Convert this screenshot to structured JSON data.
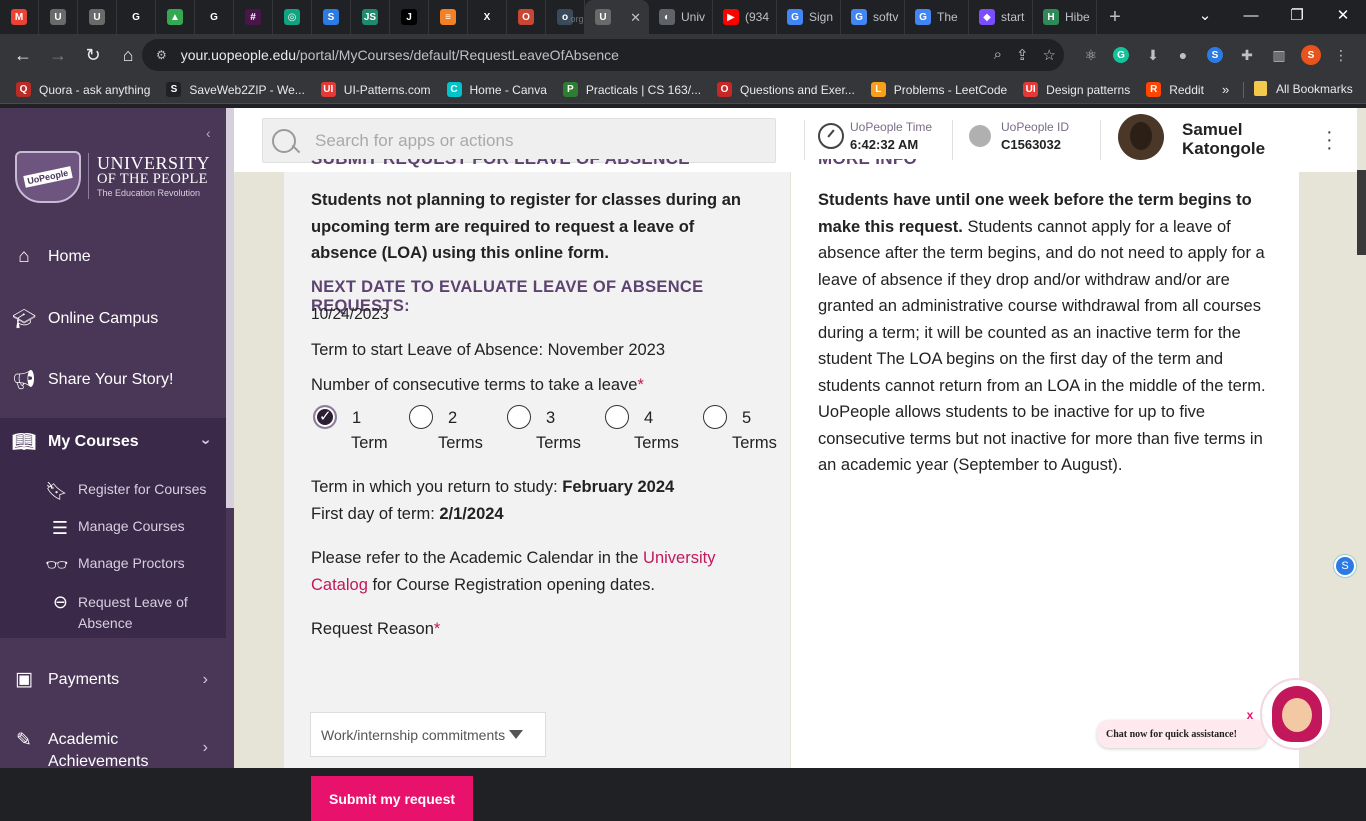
{
  "browser": {
    "tabs": [
      {
        "icon": "gmail-icon",
        "letter": "M",
        "color": "#ea4335"
      },
      {
        "icon": "uopeople-tab-icon",
        "letter": "U",
        "color": "#6a6a6a"
      },
      {
        "icon": "uopeople-tab-icon",
        "letter": "U",
        "color": "#6a6a6a"
      },
      {
        "icon": "github-icon",
        "letter": "G",
        "color": "#202124"
      },
      {
        "icon": "google-drive-icon",
        "letter": "▲",
        "color": "#34a853"
      },
      {
        "icon": "github-icon",
        "letter": "G",
        "color": "#202124"
      },
      {
        "icon": "slack-icon",
        "letter": "#",
        "color": "#4a154b"
      },
      {
        "icon": "chatgpt-icon",
        "letter": "◎",
        "color": "#10a37f"
      },
      {
        "icon": "s-icon",
        "letter": "S",
        "color": "#2c7be5"
      },
      {
        "icon": "js-icon",
        "letter": "JS",
        "color": "#1f8a70"
      },
      {
        "icon": "j-icon",
        "letter": "J",
        "color": "#000000"
      },
      {
        "icon": "stackoverflow-icon",
        "letter": "≡",
        "color": "#f48024"
      },
      {
        "icon": "x-icon",
        "letter": "X",
        "color": "#202124"
      },
      {
        "icon": "oracle-icon",
        "letter": "O",
        "color": "#c74634"
      },
      {
        "icon": "org-icon",
        "letter": "o",
        "color": "#3b4a5a",
        "title": ".org"
      }
    ],
    "active_tab_icon": "uopeople-tab-icon",
    "titled_tabs": [
      {
        "icon": "globe-icon",
        "letter": "◐",
        "color": "#5f6368",
        "title": "Univ"
      },
      {
        "icon": "youtube-icon",
        "letter": "▶",
        "color": "#ff0000",
        "title": "(934"
      },
      {
        "icon": "google-icon",
        "letter": "G",
        "color": "#4285f4",
        "title": "Sign"
      },
      {
        "icon": "google-icon",
        "letter": "G",
        "color": "#4285f4",
        "title": "softv"
      },
      {
        "icon": "google-icon",
        "letter": "G",
        "color": "#4285f4",
        "title": "The"
      },
      {
        "icon": "app-icon",
        "letter": "◆",
        "color": "#7b4dff",
        "title": "start"
      },
      {
        "icon": "hibernate-icon",
        "letter": "H",
        "color": "#2e8b57",
        "title": "Hibe"
      }
    ],
    "url_domain": "your.uopeople.edu",
    "url_path": "/portal/MyCourses/default/RequestLeaveOfAbsence",
    "bookmarks": [
      {
        "label": "Quora - ask anything",
        "letter": "Q",
        "color": "#b92b27"
      },
      {
        "label": "SaveWeb2ZIP - We...",
        "letter": "S",
        "color": "#202124"
      },
      {
        "label": "UI-Patterns.com",
        "letter": "UI",
        "color": "#e53935"
      },
      {
        "label": "Home - Canva",
        "letter": "C",
        "color": "#00c4cc"
      },
      {
        "label": "Practicals | CS 163/...",
        "letter": "P",
        "color": "#2e7d32"
      },
      {
        "label": "Questions and Exer...",
        "letter": "O",
        "color": "#c62828"
      },
      {
        "label": "Problems - LeetCode",
        "letter": "L",
        "color": "#f89f1b"
      },
      {
        "label": "Design patterns",
        "letter": "UI",
        "color": "#e53935"
      },
      {
        "label": "Reddit",
        "letter": "R",
        "color": "#ff4500"
      }
    ],
    "bookmarks_overflow": "»",
    "all_bookmarks": "All Bookmarks"
  },
  "sidebar": {
    "logo": {
      "badge": "UoPeople",
      "line1": "UNIVERSITY",
      "line2": "OF THE PEOPLE",
      "line3": "The Education Revolution"
    },
    "items": [
      {
        "label": "Home",
        "icon": "home-icon"
      },
      {
        "label": "Online Campus",
        "icon": "graduation-cap-icon"
      },
      {
        "label": "Share Your Story!",
        "icon": "megaphone-icon"
      },
      {
        "label": "My Courses",
        "icon": "book-icon"
      },
      {
        "label": "Payments",
        "icon": "wallet-icon"
      },
      {
        "label": "Academic Achievements",
        "icon": "pencil-icon"
      }
    ],
    "subitems": [
      {
        "label": "Register for Courses",
        "icon": "bookmark-icon"
      },
      {
        "label": "Manage Courses",
        "icon": "list-check-icon"
      },
      {
        "label": "Manage Proctors",
        "icon": "glasses-icon"
      },
      {
        "label": "Request Leave of Absence",
        "icon": "minus-circle-icon"
      }
    ]
  },
  "topbar": {
    "search_placeholder": "Search for apps or actions",
    "time_label": "UoPeople Time",
    "time_value": "6:42:32 AM",
    "id_label": "UoPeople ID",
    "id_value": "C1563032",
    "user_first": "Samuel",
    "user_last": "Katongole"
  },
  "form": {
    "heading_cut": "SUBMIT REQUEST FOR LEAVE OF ABSENCE",
    "intro": "Students not planning to register for classes during an upcoming term are required to request a leave of absence (LOA) using this online form.",
    "next_date_heading": "NEXT DATE TO EVALUATE LEAVE OF ABSENCE REQUESTS:",
    "next_date": "10/24/2023",
    "term_start": "Term to start Leave of Absence: November 2023",
    "terms_label": "Number of consecutive terms to take a leave",
    "required_mark": "*",
    "term_options": [
      {
        "num": "1",
        "word": "Term",
        "checked": true
      },
      {
        "num": "2",
        "word": "Terms",
        "checked": false
      },
      {
        "num": "3",
        "word": "Terms",
        "checked": false
      },
      {
        "num": "4",
        "word": "Terms",
        "checked": false
      },
      {
        "num": "5",
        "word": "Terms",
        "checked": false
      }
    ],
    "return_label": "Term in which you return to study:",
    "return_value": "February 2024",
    "first_day_label": "First day of term:",
    "first_day_value": "2/1/2024",
    "refer_text_1": "Please refer to the Academic Calendar in the",
    "refer_link": "University Catalog",
    "refer_text_2": "for Course Registration opening dates.",
    "reason_label": "Request Reason",
    "reason_value": "Work/internship commitments",
    "submit_label": "Submit my request"
  },
  "info": {
    "heading_cut": "MORE INFO",
    "bold_lead": "Students have until one week before the term begins to make this request.",
    "body": "Students cannot apply for a leave of absence after the term begins, and do not need to apply for a leave of absence if they drop and/or withdraw and/or are granted an administrative course withdrawal from all courses during a term; it will be counted as an inactive term for the student The LOA begins on the first day of the term and students cannot return from an LOA in the middle of the term. UoPeople allows students to be inactive for up to five consecutive terms but not inactive for more than five terms in an academic year (September to August)."
  },
  "chat": {
    "prompt": "Chat now for quick assistance!",
    "close": "x"
  }
}
